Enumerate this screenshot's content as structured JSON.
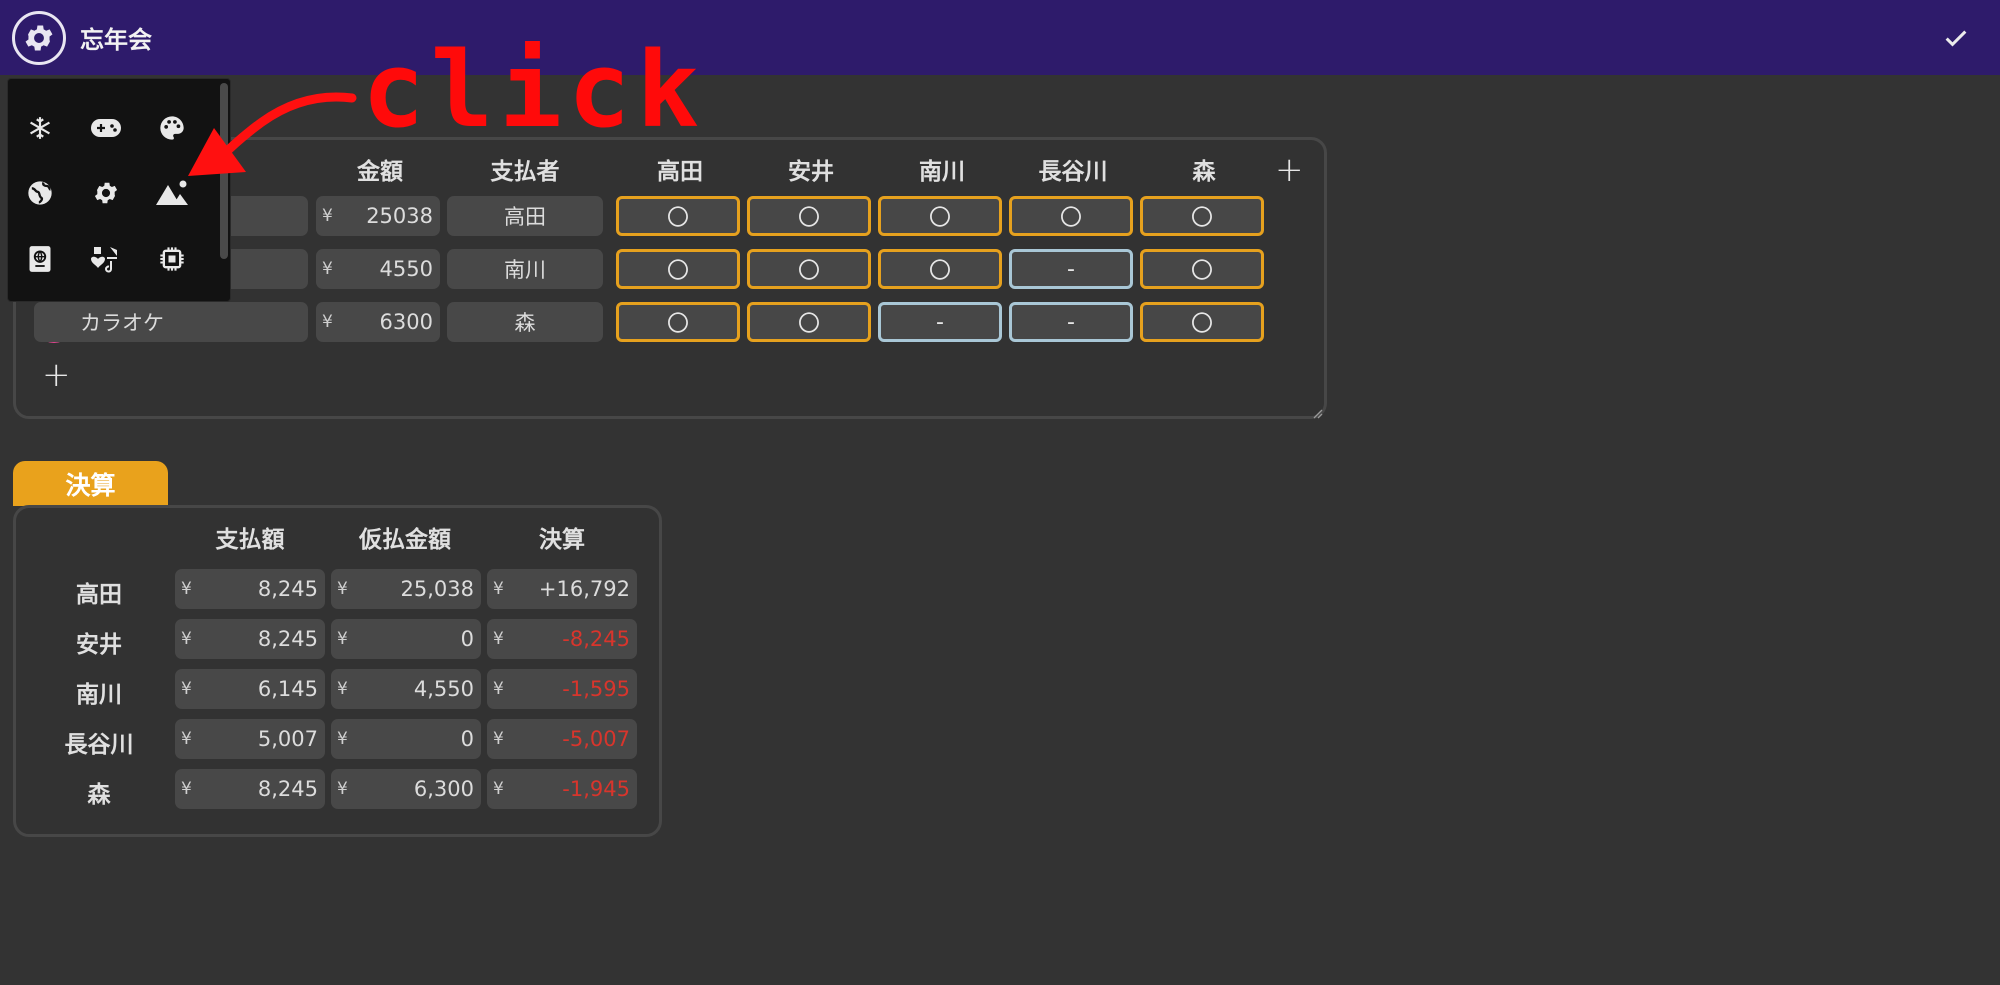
{
  "app": {
    "title": "忘年会"
  },
  "expense_table": {
    "headers": {
      "amount": "金額",
      "payer": "支払者",
      "members": [
        "高田",
        "安井",
        "南川",
        "長谷川",
        "森"
      ]
    },
    "rows": [
      {
        "name": "",
        "currency": "¥",
        "amount": "25038",
        "payer": "高田",
        "shares": [
          "〇",
          "〇",
          "〇",
          "〇",
          "〇"
        ]
      },
      {
        "name": "",
        "currency": "¥",
        "amount": "4550",
        "payer": "南川",
        "shares": [
          "〇",
          "〇",
          "〇",
          "-",
          "〇"
        ]
      },
      {
        "name": "カラオケ",
        "icon": "headphones-icon",
        "currency": "¥",
        "amount": "6300",
        "payer": "森",
        "shares": [
          "〇",
          "〇",
          "-",
          "-",
          "〇"
        ]
      }
    ],
    "add_member_label": "+",
    "add_row_label": "+"
  },
  "settlement": {
    "tab_label": "決算",
    "headers": [
      "支払額",
      "仮払金額",
      "決算"
    ],
    "currency": "¥",
    "rows": [
      {
        "name": "高田",
        "paid": "8,245",
        "advance": "25,038",
        "result": "+16,792"
      },
      {
        "name": "安井",
        "paid": "8,245",
        "advance": "0",
        "result": "-8,245"
      },
      {
        "name": "南川",
        "paid": "6,145",
        "advance": "4,550",
        "result": "-1,595"
      },
      {
        "name": "長谷川",
        "paid": "5,007",
        "advance": "0",
        "result": "-5,007"
      },
      {
        "name": "森",
        "paid": "8,245",
        "advance": "6,300",
        "result": "-1,945"
      }
    ]
  },
  "icon_picker": {
    "icons": [
      "snowflake-icon",
      "gamepad-icon",
      "palette-icon",
      "globe-icon",
      "gear-icon",
      "mountain-icon",
      "passport-icon",
      "music-note-icon",
      "chip-icon"
    ]
  },
  "annotation": {
    "text": "click"
  },
  "colors": {
    "header_bg": "#2e1b6b",
    "accent": "#e9a21c",
    "negative": "#d8352c",
    "share_on": "#e6a11e",
    "share_off": "#a9c7d6"
  }
}
